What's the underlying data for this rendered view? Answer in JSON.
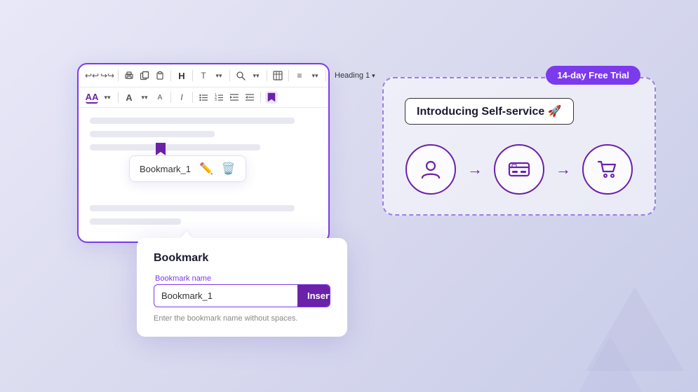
{
  "background": {
    "gradient_start": "#e8e8f8",
    "gradient_end": "#c8cce8"
  },
  "editor": {
    "heading_select_label": "Heading 1",
    "toolbar": {
      "row1_icons": [
        "undo",
        "redo",
        "print",
        "copy",
        "paste",
        "heading",
        "text-format",
        "search",
        "table",
        "more",
        "chevron"
      ],
      "row2_icons": [
        "font-color",
        "font-size-up",
        "font-size",
        "italic",
        "bullet-list",
        "numbered-list",
        "indent",
        "outdent",
        "bookmark"
      ]
    },
    "bookmark_tooltip": {
      "name": "Bookmark_1",
      "edit_icon": "✏",
      "delete_icon": "🗑"
    },
    "content_lines": [
      {
        "width": "90%"
      },
      {
        "width": "60%"
      },
      {
        "width": "75%"
      },
      {
        "width": "85%"
      },
      {
        "width": "50%"
      }
    ]
  },
  "bookmark_dialog": {
    "title": "Bookmark",
    "label": "Bookmark name",
    "input_value": "Bookmark_1",
    "insert_button_label": "Insert",
    "hint_text": "Enter the bookmark name without spaces."
  },
  "right_panel": {
    "trial_badge": "14-day Free Trial",
    "title": "Introducing Self-service 🚀",
    "flow": {
      "icons": [
        "person",
        "credit-card",
        "shopping-cart"
      ],
      "arrows": [
        "→",
        "→"
      ]
    }
  }
}
